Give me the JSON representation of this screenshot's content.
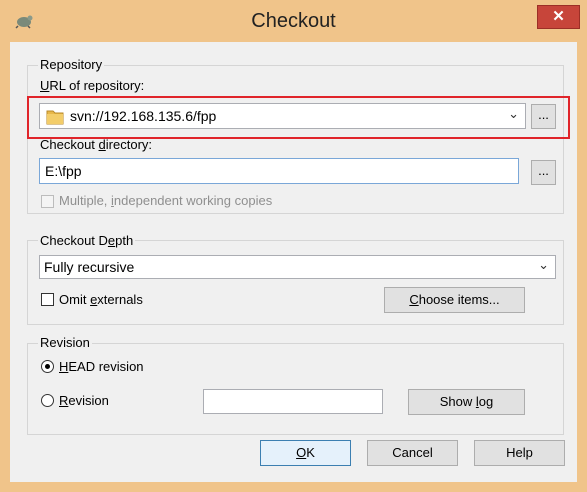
{
  "window": {
    "title": "Checkout",
    "close_glyph": "✕",
    "title_icon": "tortoisesvn-icon",
    "close_color": "#c7453a",
    "frame_color": "#f0c48a"
  },
  "repository": {
    "group_title": "Repository",
    "url_label_first": "U",
    "url_label_rest": "RL of repository:",
    "url_value": "svn://192.168.135.6/fpp",
    "browse_label": "...",
    "highlight_color": "#e0242a"
  },
  "checkout_dir": {
    "label_pre": "Checkout ",
    "label_u": "d",
    "label_post": "irectory:",
    "value": "E:\\fpp",
    "browse_label": "..."
  },
  "multiple": {
    "label_pre": "Multiple, ",
    "label_u": "i",
    "label_post": "ndependent working copies",
    "checked": false,
    "enabled": false
  },
  "depth": {
    "group_title_pre": "Checkout D",
    "group_title_u": "e",
    "group_title_post": "pth",
    "selected": "Fully recursive",
    "omit_pre": "Omit ",
    "omit_u": "e",
    "omit_post": "xternals",
    "omit_checked": false,
    "choose_pre": "",
    "choose_u": "C",
    "choose_post": "hoose items..."
  },
  "revision": {
    "group_title": "Revision",
    "head_u": "H",
    "head_post": "EAD revision",
    "head_selected": true,
    "rev_u": "R",
    "rev_post": "evision",
    "rev_value": "",
    "showlog_pre": "Show ",
    "showlog_u": "l",
    "showlog_post": "og"
  },
  "buttons": {
    "ok_u": "O",
    "ok_post": "K",
    "cancel": "Cancel",
    "help": "Help"
  }
}
